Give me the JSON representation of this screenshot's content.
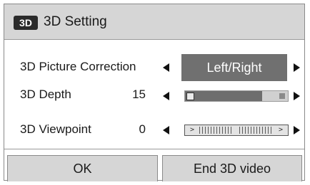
{
  "dialog": {
    "title": "3D Setting",
    "icon": "3d-icon"
  },
  "rows": {
    "picture_correction": {
      "label": "3D Picture Correction",
      "value": "Left/Right"
    },
    "depth": {
      "label": "3D Depth",
      "value": "15",
      "level_fraction": 0.75
    },
    "viewpoint": {
      "label": "3D Viewpoint",
      "value": "0"
    }
  },
  "buttons": {
    "ok": "OK",
    "end": "End 3D video"
  },
  "colors": {
    "title_bar": "#d6d6d6",
    "selected_value_bg": "#707070",
    "selected_value_text": "#ffffff",
    "slider_fill": "#6e6e6e"
  }
}
